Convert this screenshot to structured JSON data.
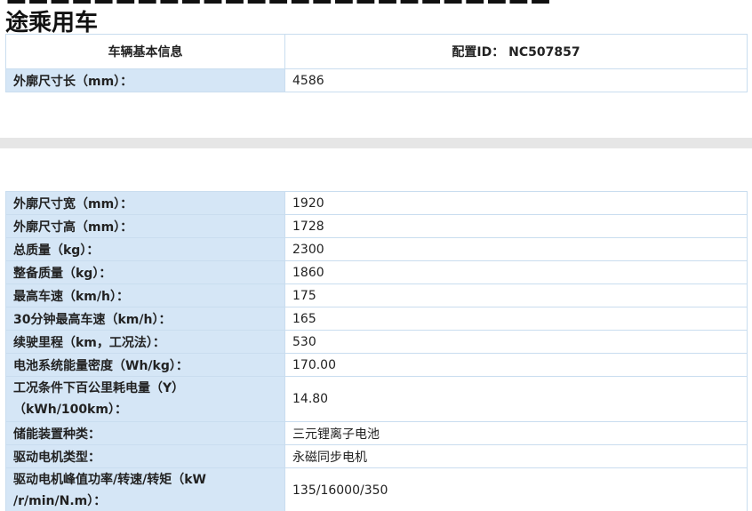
{
  "title_line2": "途乘用车",
  "header": {
    "left": "车辆基本信息",
    "right_label": "配置ID：",
    "right_value": "NC507857"
  },
  "top_rows": [
    {
      "label": "外廓尺寸长（mm）：",
      "value": "4586"
    }
  ],
  "rows": [
    {
      "label": "外廓尺寸宽（mm）：",
      "value": "1920"
    },
    {
      "label": "外廓尺寸高（mm）：",
      "value": "1728"
    },
    {
      "label": "总质量（kg）：",
      "value": "2300"
    },
    {
      "label": "整备质量（kg）：",
      "value": "1860"
    },
    {
      "label": "最高车速（km/h）：",
      "value": "175"
    },
    {
      "label": "30分钟最高车速（km/h）：",
      "value": "165"
    },
    {
      "label": "续驶里程（km，工况法）：",
      "value": "530"
    },
    {
      "label": "电池系统能量密度（Wh/kg）：",
      "value": "170.00"
    },
    {
      "label_line1": "工况条件下百公里耗电量（Y）",
      "label_line2": "（kWh/100km）：",
      "value": "14.80"
    },
    {
      "label": "储能装置种类：",
      "value": "三元锂离子电池"
    },
    {
      "label": "驱动电机类型：",
      "value": "永磁同步电机"
    },
    {
      "label_line1": "驱动电机峰值功率/转速/转矩（kW",
      "label_line2": "/r/min/N.m）：",
      "value": "135/16000/350"
    }
  ]
}
